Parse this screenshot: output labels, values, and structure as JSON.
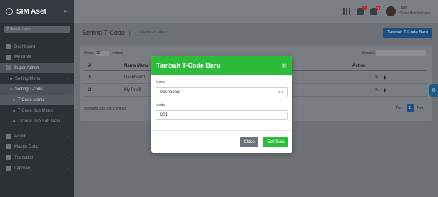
{
  "brand": {
    "name": "SIM Aset"
  },
  "sidebar": {
    "search_placeholder": "Search menu",
    "items": [
      {
        "label": "Dashboard"
      },
      {
        "label": "My Profil"
      },
      {
        "label": "Super Admin"
      },
      {
        "label": "Setting Menu"
      },
      {
        "label": "Setting T-code"
      },
      {
        "label": "T-Code Menu"
      },
      {
        "label": "T-Code Sub Menu"
      },
      {
        "label": "T-Code Sub Sub Menu"
      },
      {
        "label": "Admin"
      },
      {
        "label": "Master Data"
      },
      {
        "label": "Transaksi"
      },
      {
        "label": "Laporan"
      }
    ]
  },
  "topbar": {
    "notif_count_1": "1",
    "notif_count_2": "2",
    "user_name": "Jefri",
    "user_role": "Super Administrator"
  },
  "header": {
    "title": "Setting T-Code",
    "breadcrumb": "Tambah Menu",
    "new_button": "Tambah T-Code Baru"
  },
  "table": {
    "show_label": "Show",
    "show_value": "10",
    "entries_label": "entries",
    "search_label": "Search:",
    "columns": [
      "#",
      "Nama Menu",
      "Action"
    ],
    "rows": [
      {
        "no": "1",
        "menu": "Dashboard"
      },
      {
        "no": "2",
        "menu": "My Profil"
      }
    ],
    "showing": "Showing 1 to 2 of 2 entries",
    "prev": "Prev",
    "page": "1",
    "next": "Next"
  },
  "modal": {
    "title": "Tambah T-Code Baru",
    "menu_label": "Menu",
    "menu_value": "Dashboard",
    "tcode_label": "tcode",
    "tcode_value": "D01",
    "close_button": "Close",
    "save_button": "Edit Data"
  },
  "colors": {
    "modal_header": "#2dbb3c",
    "primary_button": "#1f4f7f",
    "sidebar": "#2c3136"
  }
}
